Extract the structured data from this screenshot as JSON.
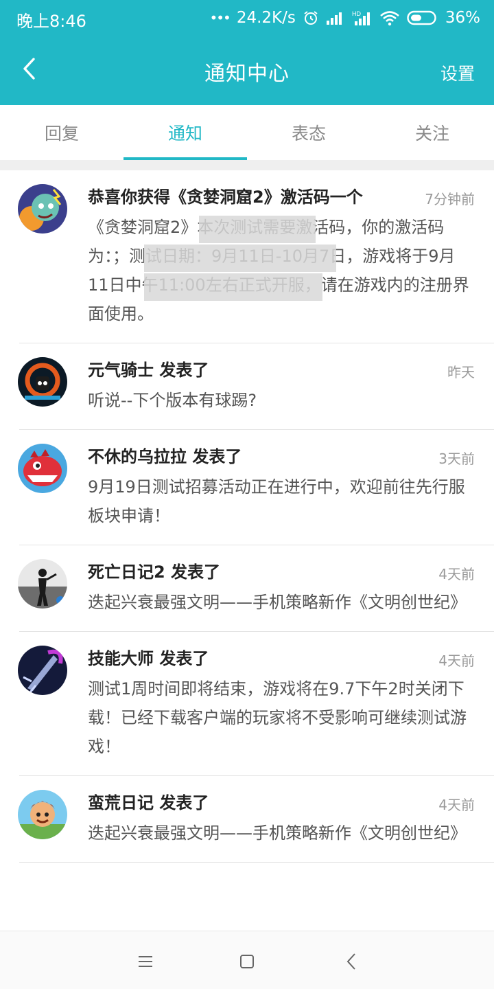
{
  "status": {
    "time": "晚上8:46",
    "dots": "•••",
    "speed": "24.2K/s",
    "battery": "36%",
    "icons": [
      "alarm-icon",
      "signal-icon",
      "hd-signal-icon",
      "wifi-icon",
      "battery-icon"
    ]
  },
  "nav": {
    "title": "通知中心",
    "settings": "设置",
    "back_icon": "chevron-left-icon"
  },
  "tabs": [
    {
      "label": "回复",
      "active": false
    },
    {
      "label": "通知",
      "active": true
    },
    {
      "label": "表态",
      "active": false
    },
    {
      "label": "关注",
      "active": false
    }
  ],
  "notifications": [
    {
      "title": "恭喜你获得《贪婪洞窟2》激活码一个",
      "time": "7分钟前",
      "body": "《贪婪洞窟2》本次测试需要激活码，你的激活码为：；测试日期：9月11日-10月7日，游戏将于9月11日中午11:00左右正式开服，请在游戏内的注册界面使用。",
      "avatar": "avatar-greedy-cave"
    },
    {
      "title": "元气骑士 发表了",
      "time": "昨天",
      "body": "听说--下个版本有球踢?",
      "avatar": "avatar-soul-knight"
    },
    {
      "title": "不休的乌拉拉 发表了",
      "time": "3天前",
      "body": "9月19日测试招募活动正在进行中，欢迎前往先行服板块申请！",
      "avatar": "avatar-ulala"
    },
    {
      "title": "死亡日记2 发表了",
      "time": "4天前",
      "body": "迭起兴衰最强文明——手机策略新作《文明创世纪》",
      "avatar": "avatar-death-diary"
    },
    {
      "title": "技能大师 发表了",
      "time": "4天前",
      "body": "测试1周时间即将结束，游戏将在9.7下午2时关闭下载！已经下载客户端的玩家将不受影响可继续测试游戏！",
      "avatar": "avatar-skill-master"
    },
    {
      "title": "蛮荒日记 发表了",
      "time": "4天前",
      "body": "迭起兴衰最强文明——手机策略新作《文明创世纪》",
      "avatar": "avatar-wild-diary"
    }
  ],
  "colors": {
    "accent": "#21b8c6",
    "title_text": "#222222",
    "body_text": "#555555",
    "time_text": "#9a9a9a"
  },
  "system_nav": [
    "menu-icon",
    "home-icon",
    "back-icon"
  ]
}
